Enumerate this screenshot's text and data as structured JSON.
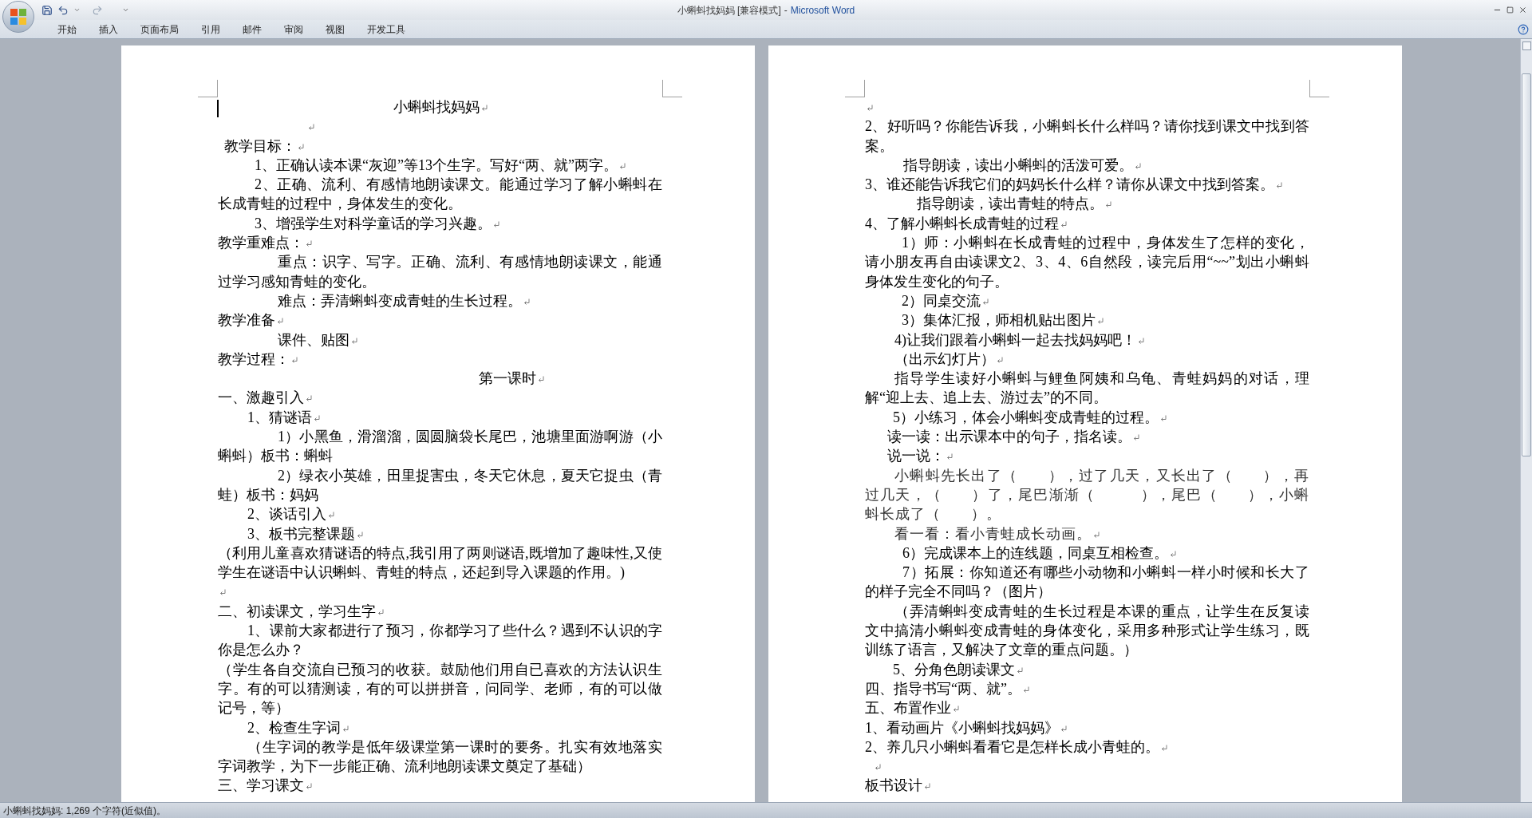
{
  "window": {
    "document_title": "小蝌蚪找妈妈 [兼容模式]",
    "separator": "-",
    "app_name": "Microsoft Word"
  },
  "ribbon_tabs": [
    {
      "label": "开始"
    },
    {
      "label": "插入"
    },
    {
      "label": "页面布局"
    },
    {
      "label": "引用"
    },
    {
      "label": "邮件"
    },
    {
      "label": "审阅"
    },
    {
      "label": "视图"
    },
    {
      "label": "开发工具"
    }
  ],
  "pages": [
    {
      "paragraphs": [
        {
          "kind": "title",
          "text": "小蝌蚪找妈妈"
        },
        {
          "kind": "blank"
        },
        {
          "kind": "body",
          "text": "教学目标："
        },
        {
          "kind": "body",
          "text": "1、正确认读本课“灰迎”等13个生字。写好“两、就”两字。"
        },
        {
          "kind": "wrapped",
          "text": "2、正确、流利、有感情地朗读课文。能通过学习了解小蝌蚪在长成青蛙的过程中，身体发生的变化。"
        },
        {
          "kind": "body",
          "text": "3、增强学生对科学童话的学习兴趣。"
        },
        {
          "kind": "body",
          "text": "教学重难点："
        },
        {
          "kind": "wrapped",
          "text": "重点：识字、写字。正确、流利、有感情地朗读课文，能通过学习感知青蛙的变化。"
        },
        {
          "kind": "body",
          "text": "难点：弄清蝌蚪变成青蛙的生长过程。"
        },
        {
          "kind": "body",
          "text": "教学准备"
        },
        {
          "kind": "body",
          "text": "课件、贴图"
        },
        {
          "kind": "body",
          "text": "教学过程："
        },
        {
          "kind": "subtitle",
          "text": "第一课时"
        },
        {
          "kind": "body",
          "text": "一、激趣引入"
        },
        {
          "kind": "body",
          "text": "1、猜谜语"
        },
        {
          "kind": "wrapped",
          "text": "1）小黑鱼，滑溜溜，圆圆脑袋长尾巴，池塘里面游啊游（小蝌蚪）板书：蝌蚪"
        },
        {
          "kind": "wrapped",
          "text": "2）绿衣小英雄，田里捉害虫，冬天它休息，夏天它捉虫（青蛙）板书：妈妈"
        },
        {
          "kind": "body",
          "text": "2、谈话引入"
        },
        {
          "kind": "body",
          "text": "3、板书完整课题"
        },
        {
          "kind": "wrapped",
          "text": "（利用儿童喜欢猜谜语的特点,我引用了两则谜语,既增加了趣味性,又使学生在谜语中认识蝌蚪、青蛙的特点，还起到导入课题的作用。)"
        },
        {
          "kind": "blank"
        },
        {
          "kind": "body",
          "text": "二、初读课文，学习生字"
        },
        {
          "kind": "wrapped",
          "text": "1、课前大家都进行了预习，你都学习了些什么？遇到不认识的字你是怎么办？"
        },
        {
          "kind": "wrapped",
          "text": "（学生各自交流自已预习的收获。鼓励他们用自已喜欢的方法认识生字。有的可以猜测读，有的可以拼拼音，问同学、老师，有的可以做记号，等）"
        },
        {
          "kind": "body",
          "text": "2、检查生字词"
        },
        {
          "kind": "wrapped",
          "text": "（生字词的教学是低年级课堂第一课时的要务。扎实有效地落实字词教学，为下一步能正确、流利地朗读课文奠定了基础）"
        },
        {
          "kind": "body",
          "text": "三、学习课文"
        }
      ]
    },
    {
      "paragraphs": [
        {
          "kind": "blank"
        },
        {
          "kind": "wrapped",
          "text": "2、好听吗？你能告诉我，小蝌蚪长什么样吗？请你找到课文中找到答案。"
        },
        {
          "kind": "body",
          "text": "指导朗读，读出小蝌蚪的活泼可爱。"
        },
        {
          "kind": "body",
          "text": "3、谁还能告诉我它们的妈妈长什么样？请你从课文中找到答案。"
        },
        {
          "kind": "body",
          "text": "指导朗读，读出青蛙的特点。"
        },
        {
          "kind": "body",
          "text": "4、了解小蝌蚪长成青蛙的过程"
        },
        {
          "kind": "wrapped",
          "text": "1）师：小蝌蚪在长成青蛙的过程中，身体发生了怎样的变化，请小朋友再自由读课文2、3、4、6自然段，读完后用“~~”划出小蝌蚪身体发生变化的句子。"
        },
        {
          "kind": "body",
          "text": "2）同桌交流"
        },
        {
          "kind": "body",
          "text": "3）集体汇报，师相机贴出图片"
        },
        {
          "kind": "body",
          "text": "4)让我们跟着小蝌蚪一起去找妈妈吧！"
        },
        {
          "kind": "body",
          "text": "（出示幻灯片）"
        },
        {
          "kind": "wrapped",
          "text": "指导学生读好小蝌蚪与鲤鱼阿姨和乌龟、青蛙妈妈的对话，理解“迎上去、追上去、游过去”的不同。"
        },
        {
          "kind": "body",
          "text": "5）小练习，体会小蝌蚪变成青蛙的过程。"
        },
        {
          "kind": "body",
          "text": "读一读：出示课本中的句子，指名读。"
        },
        {
          "kind": "body",
          "text": "说一说："
        },
        {
          "kind": "spaced_wrapped",
          "text": "小蝌蚪先长出了（　　），过了几天，又长出了（　　），再过几天，（　　）了，尾巴渐渐（　　　），尾巴（　　），小蝌蚪长成了（　　）。"
        },
        {
          "kind": "spaced",
          "text": "看一看：看小青蛙成长动画。"
        },
        {
          "kind": "body",
          "text": "6）完成课本上的连线题，同桌互相检查。"
        },
        {
          "kind": "wrapped",
          "text": "7）拓展：你知道还有哪些小动物和小蝌蚪一样小时候和长大了的样子完全不同吗？（图片）"
        },
        {
          "kind": "wrapped",
          "text": "（弄清蝌蚪变成青蛙的生长过程是本课的重点，让学生在反复读文中搞清小蝌蚪变成青蛙的身体变化，采用多种形式让学生练习，既训练了语言，又解决了文章的重点问题。）"
        },
        {
          "kind": "body",
          "text": "5、分角色朗读课文"
        },
        {
          "kind": "body",
          "text": "四、指导书写“两、就”。"
        },
        {
          "kind": "body",
          "text": "五、布置作业"
        },
        {
          "kind": "body",
          "text": "1、看动画片《小蝌蚪找妈妈》"
        },
        {
          "kind": "body",
          "text": "2、养几只小蝌蚪看看它是怎样长成小青蛙的。"
        },
        {
          "kind": "blank"
        },
        {
          "kind": "body",
          "text": "板书设计"
        }
      ]
    }
  ],
  "status_bar": {
    "text": "小蝌蚪找妈妈: 1,269 个字符(近似值)。"
  }
}
